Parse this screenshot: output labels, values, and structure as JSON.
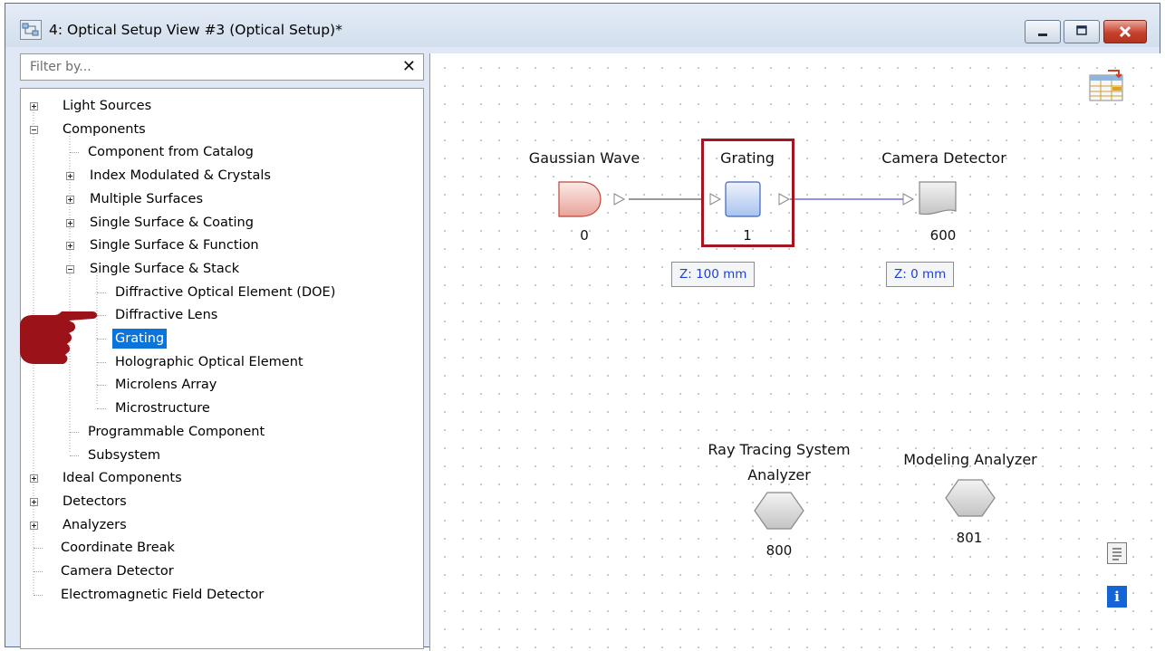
{
  "window": {
    "title": "4: Optical Setup View #3 (Optical Setup)*",
    "buttons": [
      "minimize",
      "maximize",
      "close"
    ]
  },
  "filter": {
    "placeholder": "Filter by...",
    "clear_label": "✕"
  },
  "tree": {
    "items": [
      {
        "label": "Light Sources",
        "level": 0,
        "expander": "plus"
      },
      {
        "label": "Components",
        "level": 0,
        "expander": "minus"
      },
      {
        "label": "Component from Catalog",
        "level": 1,
        "expander": "none"
      },
      {
        "label": "Index Modulated & Crystals",
        "level": 1,
        "expander": "plus"
      },
      {
        "label": "Multiple Surfaces",
        "level": 1,
        "expander": "plus"
      },
      {
        "label": "Single Surface & Coating",
        "level": 1,
        "expander": "plus"
      },
      {
        "label": "Single Surface & Function",
        "level": 1,
        "expander": "plus"
      },
      {
        "label": "Single Surface & Stack",
        "level": 1,
        "expander": "minus"
      },
      {
        "label": "Diffractive Optical Element (DOE)",
        "level": 2,
        "expander": "none"
      },
      {
        "label": "Diffractive Lens",
        "level": 2,
        "expander": "none"
      },
      {
        "label": "Grating",
        "level": 2,
        "expander": "none",
        "selected": true
      },
      {
        "label": "Holographic Optical Element",
        "level": 2,
        "expander": "none"
      },
      {
        "label": "Microlens Array",
        "level": 2,
        "expander": "none"
      },
      {
        "label": "Microstructure",
        "level": 2,
        "expander": "none"
      },
      {
        "label": "Programmable Component",
        "level": 1,
        "expander": "none"
      },
      {
        "label": "Subsystem",
        "level": 1,
        "expander": "none"
      },
      {
        "label": "Ideal Components",
        "level": 0,
        "expander": "plus"
      },
      {
        "label": "Detectors",
        "level": 0,
        "expander": "plus"
      },
      {
        "label": "Analyzers",
        "level": 0,
        "expander": "plus"
      },
      {
        "label": "Coordinate Break",
        "level": 0,
        "expander": "none"
      },
      {
        "label": "Camera Detector",
        "level": 0,
        "expander": "none"
      },
      {
        "label": "Electromagnetic Field Detector",
        "level": 0,
        "expander": "none"
      }
    ]
  },
  "canvas": {
    "nodes": {
      "gaussian": {
        "label": "Gaussian Wave",
        "id": "0"
      },
      "grating": {
        "label": "Grating",
        "id": "1",
        "z": "Z: 100 mm"
      },
      "camera": {
        "label": "Camera Detector",
        "id": "600",
        "z": "Z: 0 mm"
      },
      "raytracing": {
        "label_line1": "Ray Tracing System",
        "label_line2": "Analyzer",
        "id": "800"
      },
      "modeling": {
        "label": "Modeling Analyzer",
        "id": "801"
      }
    },
    "side_icons": [
      "table-icon",
      "document-icon",
      "info-icon"
    ]
  },
  "colors": {
    "selection": "#0a74da",
    "highlight_box": "#a3161d",
    "pointer": "#9b1219",
    "z_text": "#1d3fd8",
    "beam_after_grating": "#6f6fe8"
  }
}
